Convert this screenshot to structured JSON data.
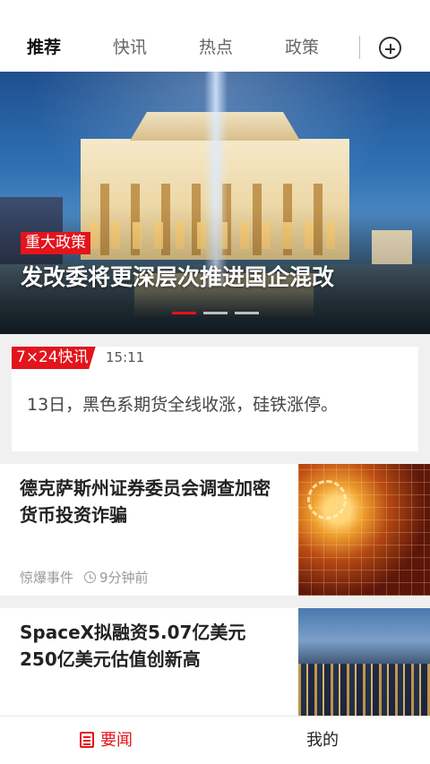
{
  "tabs": [
    {
      "label": "推荐",
      "active": true
    },
    {
      "label": "快讯",
      "active": false
    },
    {
      "label": "热点",
      "active": false
    },
    {
      "label": "政策",
      "active": false
    }
  ],
  "hero": {
    "tag": "重大政策",
    "title": "发改委将更深层次推进国企混改",
    "slide_count": 3,
    "active_slide": 1
  },
  "flash": {
    "badge": "7×24快讯",
    "time": "15:11",
    "text": "13日，黑色系期货全线收涨，硅铁涨停。"
  },
  "news": [
    {
      "title": "德克萨斯州证券委员会调查加密货币投资诈骗",
      "category": "惊爆事件",
      "time": "9分钟前",
      "thumbnail": "digital-finance-image"
    },
    {
      "title": "SpaceX拟融资5.07亿美元250亿美元估值创新高",
      "thumbnail": "city-skyline-image"
    }
  ],
  "bottom_nav": [
    {
      "label": "要闻",
      "icon": "document-icon",
      "active": true
    },
    {
      "label": "我的",
      "active": false
    }
  ],
  "colors": {
    "accent": "#e3141c",
    "text_primary": "#222222",
    "text_secondary": "#999999"
  }
}
